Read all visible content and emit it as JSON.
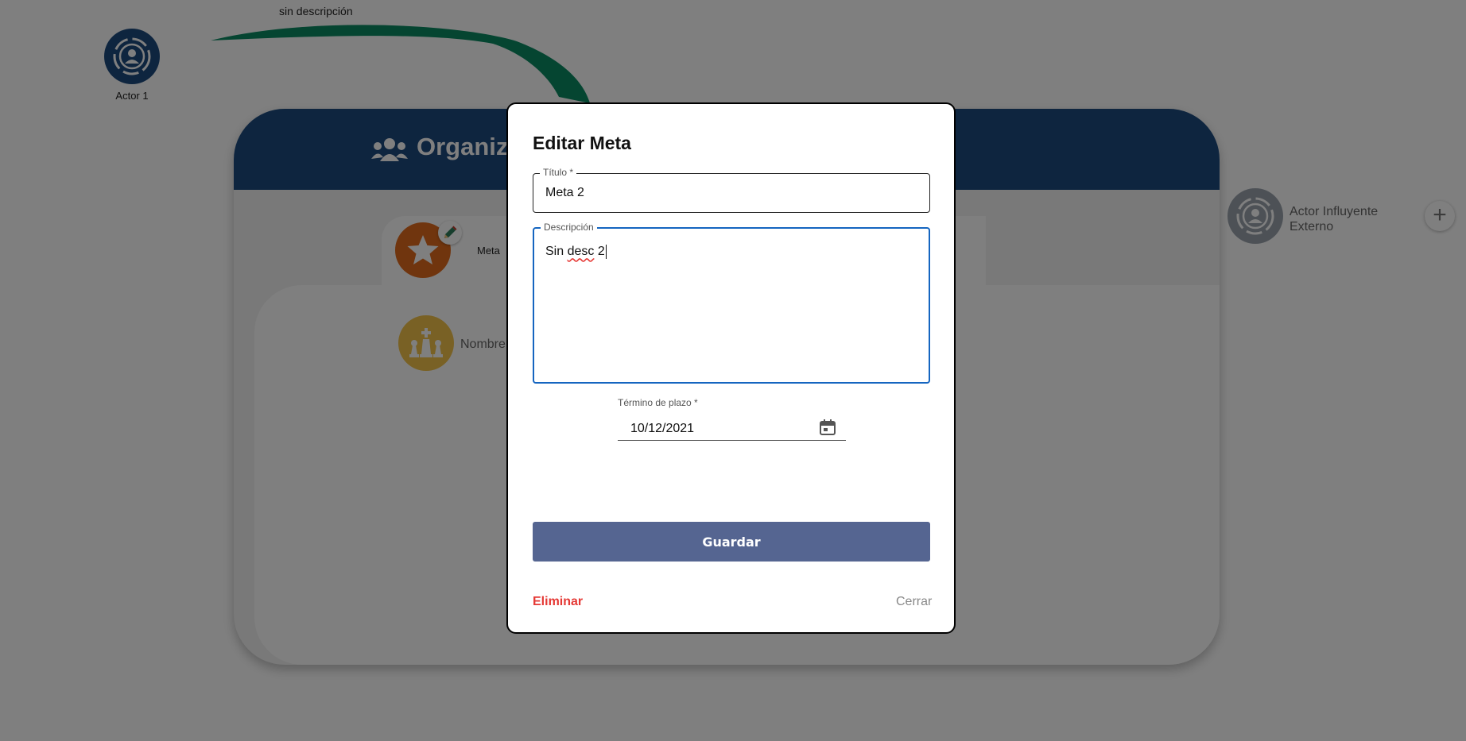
{
  "background": {
    "arrow_label": "sin descripción",
    "actor1_label": "Actor 1",
    "org_title": "Organiz",
    "meta_label": "Meta",
    "nombre_label": "Nombre",
    "external_actor_label": "Actor Influyente\nExterno",
    "colors": {
      "header": "#1c4a7e",
      "arrow": "#0a8a63",
      "meta_circle": "#e06a1c",
      "chess_circle": "#f2c34a",
      "external_circle": "#9aa3ad"
    }
  },
  "modal": {
    "title": "Editar Meta",
    "titulo": {
      "label": "Título *",
      "value": "Meta 2"
    },
    "descripcion": {
      "label": "Descripción",
      "value_prefix": "Sin ",
      "value_spell": "desc",
      "value_suffix": " 2"
    },
    "termino": {
      "label": "Término de plazo *",
      "value": "10/12/2021"
    },
    "save_label": "Guardar",
    "delete_label": "Eliminar",
    "close_label": "Cerrar",
    "colors": {
      "save_button": "#556591",
      "focus": "#1565c0",
      "delete": "#e53935"
    }
  },
  "icons": {
    "actor1": "actor-broadcast-icon",
    "org": "people-group-icon",
    "meta": "star-icon",
    "edit": "pencil-icon",
    "chess": "chess-pieces-icon",
    "external": "actor-broadcast-icon",
    "add": "plus-icon",
    "calendar": "calendar-icon"
  }
}
